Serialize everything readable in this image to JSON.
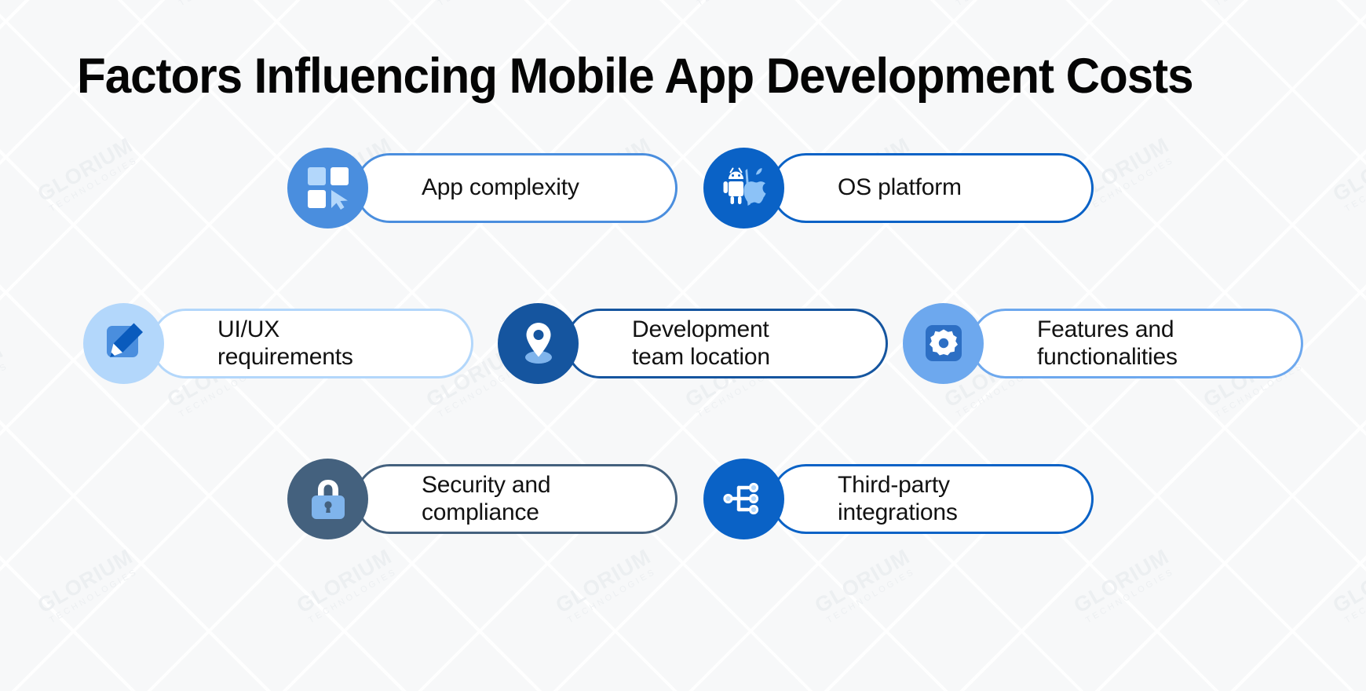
{
  "page": {
    "title": "Factors Influencing Mobile App Development Costs",
    "background_color": "#f7f8f9",
    "watermark_main": "GLORIUM",
    "watermark_sub": "TECHNOLOGIES"
  },
  "colors": {
    "blue_medium": "#4a8ede",
    "blue_strong": "#0a62c6",
    "blue_pale": "#b3d7fb",
    "blue_navy": "#15559f",
    "blue_light": "#6da8ee",
    "slate": "#44617e",
    "text_dark": "#121212",
    "card_bg": "#ffffff"
  },
  "cards": [
    {
      "id": "app-complexity",
      "icon": "grid-cursor-icon",
      "label_line1": "App complexity",
      "label_line2": "",
      "circle_color": "#4a8ede",
      "border_color": "#4a8ede",
      "row": 1
    },
    {
      "id": "os-platform",
      "icon": "android-apple-icon",
      "label_line1": "OS platform",
      "label_line2": "",
      "circle_color": "#0a62c6",
      "border_color": "#0a62c6",
      "row": 1
    },
    {
      "id": "uiux",
      "icon": "pencil-edit-icon",
      "label_line1": "UI/UX",
      "label_line2": "requirements",
      "circle_color": "#b3d7fb",
      "border_color": "#b3d7fb",
      "row": 2
    },
    {
      "id": "dev-location",
      "icon": "map-pin-person-icon",
      "label_line1": "Development",
      "label_line2": "team location",
      "circle_color": "#15559f",
      "border_color": "#15559f",
      "row": 2
    },
    {
      "id": "features",
      "icon": "gear-icon",
      "label_line1": "Features and",
      "label_line2": "functionalities",
      "circle_color": "#6da8ee",
      "border_color": "#6da8ee",
      "row": 2
    },
    {
      "id": "security",
      "icon": "lock-icon",
      "label_line1": "Security and",
      "label_line2": "compliance",
      "circle_color": "#44617e",
      "border_color": "#44617e",
      "row": 3
    },
    {
      "id": "integrations",
      "icon": "node-network-icon",
      "label_line1": "Third-party",
      "label_line2": "integrations",
      "circle_color": "#0a62c6",
      "border_color": "#0a62c6",
      "row": 3
    }
  ]
}
